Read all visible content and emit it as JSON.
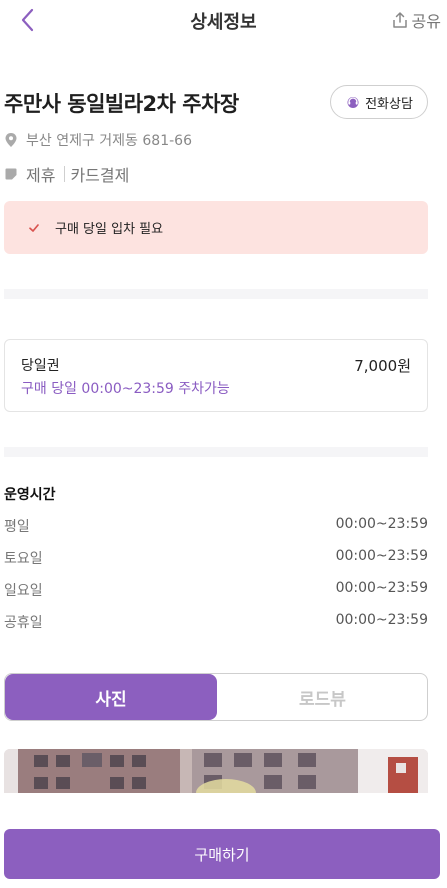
{
  "header": {
    "title": "상세정보",
    "share_label": "공유"
  },
  "lot": {
    "name": "주만사 동일빌라2차 주차장",
    "call_label": "전화상담",
    "address": "부산 연제구 거제동 681-66",
    "tags": [
      "제휴",
      "카드결제"
    ]
  },
  "notice": {
    "text": "구매 당일 입차 필요"
  },
  "ticket": {
    "name": "당일권",
    "price": "7,000원",
    "desc": "구매 당일 00:00~23:59 주차가능"
  },
  "hours": {
    "title": "운영시간",
    "rows": [
      {
        "day": "평일",
        "time": "00:00~23:59"
      },
      {
        "day": "토요일",
        "time": "00:00~23:59"
      },
      {
        "day": "일요일",
        "time": "00:00~23:59"
      },
      {
        "day": "공휴일",
        "time": "00:00~23:59"
      }
    ]
  },
  "media_tabs": {
    "photo": "사진",
    "road_view": "로드뷰",
    "selected": "사진"
  },
  "buy_button": {
    "label": "구매하기"
  },
  "colors": {
    "accent": "#8c5fbf",
    "notice_bg": "#fde3e0",
    "check": "#d9534f"
  }
}
